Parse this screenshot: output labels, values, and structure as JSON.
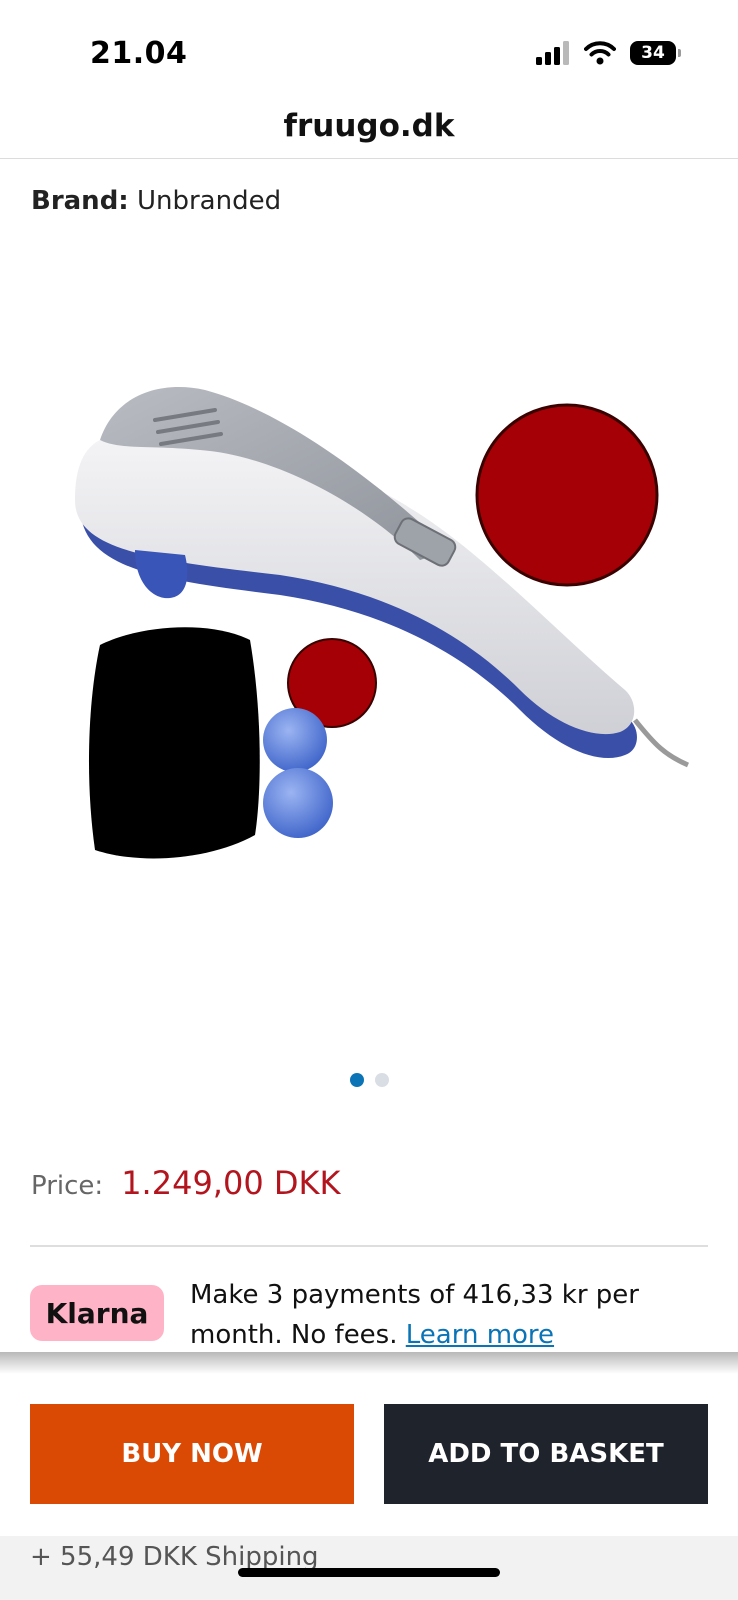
{
  "status_bar": {
    "time": "21.04",
    "battery_level": "34",
    "signal_icon": "cellular-signal-icon",
    "wifi_icon": "wifi-icon",
    "battery_icon": "battery-icon"
  },
  "browser": {
    "url": "fruugo.dk"
  },
  "product": {
    "brand_label": "Brand:",
    "brand_value": "Unbranded",
    "image_icon": "handheld-massager-product-image",
    "carousel": {
      "total_images": 2,
      "active_index": 0
    }
  },
  "price": {
    "label": "Price:",
    "value": "1.249,00 DKK"
  },
  "klarna": {
    "logo": "Klarna",
    "message": "Make 3 payments of 416,33 kr per month. No fees.",
    "link": "Learn more"
  },
  "actions": {
    "buy_now": "BUY NOW",
    "add_to_basket": "ADD TO BASKET"
  },
  "shipping": {
    "text": "+ 55,49 DKK Shipping"
  },
  "colors": {
    "price": "#b3151e",
    "buy_now": "#db4a05",
    "add_to_basket": "#1f232b",
    "klarna_badge": "#ffb3c7",
    "link": "#0b74b6"
  }
}
